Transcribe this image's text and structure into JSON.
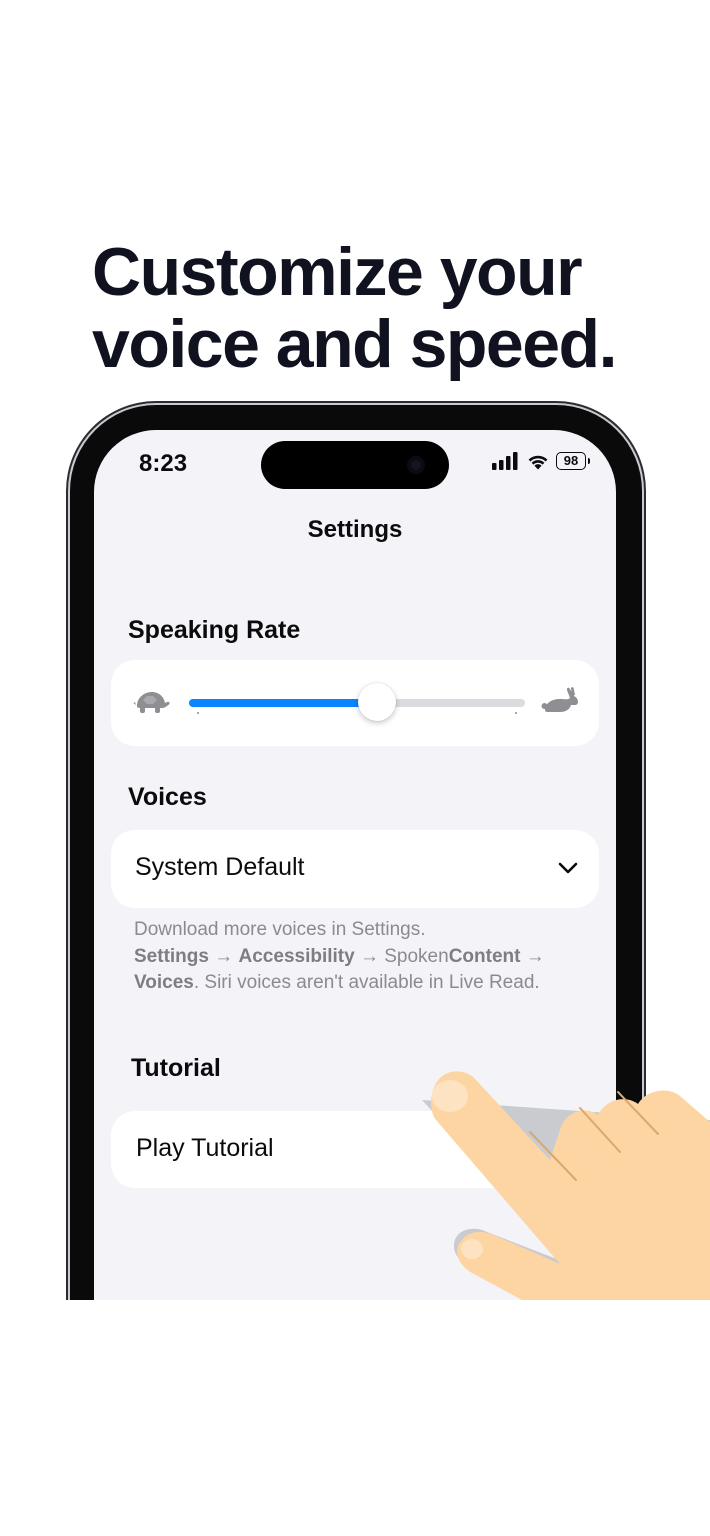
{
  "headline": {
    "line1": "Customize your",
    "line2": "voice and speed."
  },
  "status_bar": {
    "time": "8:23",
    "battery": "98",
    "icons": [
      "signal-icon",
      "wifi-icon",
      "battery-icon"
    ]
  },
  "nav": {
    "title": "Settings"
  },
  "speaking_rate": {
    "header": "Speaking Rate",
    "slider_value": 0.56,
    "left_icon": "turtle-icon",
    "right_icon": "rabbit-icon"
  },
  "voices": {
    "header": "Voices",
    "selected": "System Default",
    "dropdown_icon": "chevron-down-icon",
    "footnote": {
      "line1": "Download more voices in Settings.",
      "path1": "Settings",
      "arrow": "→",
      "path2": "Accessibility",
      "path3": "Spoken",
      "path3b": "Content",
      "path4": "Voices",
      "rest": ". Siri voices aren't available in Live Read."
    }
  },
  "tutorial": {
    "header": "Tutorial",
    "row_label": "Play Tutorial"
  },
  "colors": {
    "accent": "#0a84ff",
    "background": "#f4f3f8",
    "card": "#ffffff",
    "hand": "#fcd5a3"
  }
}
